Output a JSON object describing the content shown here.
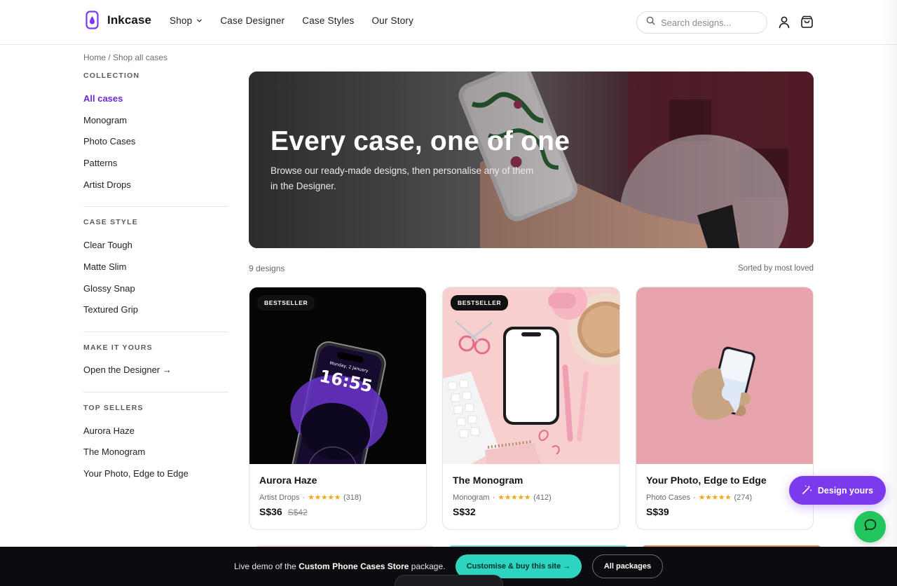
{
  "brand": {
    "name": "Inkcase",
    "accent": "#7c3aed"
  },
  "nav": {
    "items": [
      {
        "label": "Shop",
        "has_dropdown": true
      },
      {
        "label": "Case Designer"
      },
      {
        "label": "Case Styles"
      },
      {
        "label": "Our Story"
      }
    ]
  },
  "search": {
    "placeholder": "Search designs..."
  },
  "header_icons": [
    "user-icon",
    "cart-icon"
  ],
  "breadcrumb": "Home / Shop all cases",
  "sidebar": {
    "collection": {
      "title": "COLLECTION",
      "items": [
        "All cases",
        "Monogram",
        "Photo Cases",
        "Patterns",
        "Artist Drops"
      ],
      "active": "All cases"
    },
    "case_style": {
      "title": "CASE STYLE",
      "items": [
        "Clear Tough",
        "Matte Slim",
        "Glossy Snap",
        "Textured Grip"
      ]
    },
    "make_it_yours": {
      "title": "MAKE IT YOURS",
      "link": "Open the Designer →"
    },
    "top_sellers": {
      "title": "TOP SELLERS",
      "items": [
        "Aurora Haze",
        "The Monogram",
        "Your Photo, Edge to Edge"
      ]
    }
  },
  "hero": {
    "title": "Every case, one of one",
    "subtitle": "Browse our ready-made designs, then personalise any of them in the Designer."
  },
  "listing": {
    "count": "9 designs",
    "sort": "Sorted by most loved"
  },
  "products": [
    {
      "name": "Aurora Haze",
      "category": "Artist Drops",
      "stars": "★★★★★",
      "reviews": "(318)",
      "price": "S$36",
      "old_price": "S$42",
      "badge": "BESTSELLER",
      "phone_time": "16:55",
      "phone_date": "Monday, 2 January"
    },
    {
      "name": "The Monogram",
      "category": "Monogram",
      "stars": "★★★★★",
      "reviews": "(412)",
      "price": "S$32",
      "old_price": "",
      "badge": "BESTSELLER"
    },
    {
      "name": "Your Photo, Edge to Edge",
      "category": "Photo Cases",
      "stars": "★★★★★",
      "reviews": "(274)",
      "price": "S$39",
      "old_price": "",
      "badge": ""
    }
  ],
  "floating": {
    "design_button": "Design yours",
    "chat_icon": "chat-icon"
  },
  "demo_bar": {
    "prefix": "Live demo of the ",
    "package": "Custom Phone Cases Store",
    "suffix": " package.",
    "cta_primary": "Customise & buy this site →",
    "cta_secondary": "All packages"
  },
  "colors": {
    "badge_bg": "#111111",
    "star": "#f2a825",
    "teal": "#2dd4bf",
    "chat": "#22c55e",
    "demo_bar_bg": "#0c0c10"
  }
}
